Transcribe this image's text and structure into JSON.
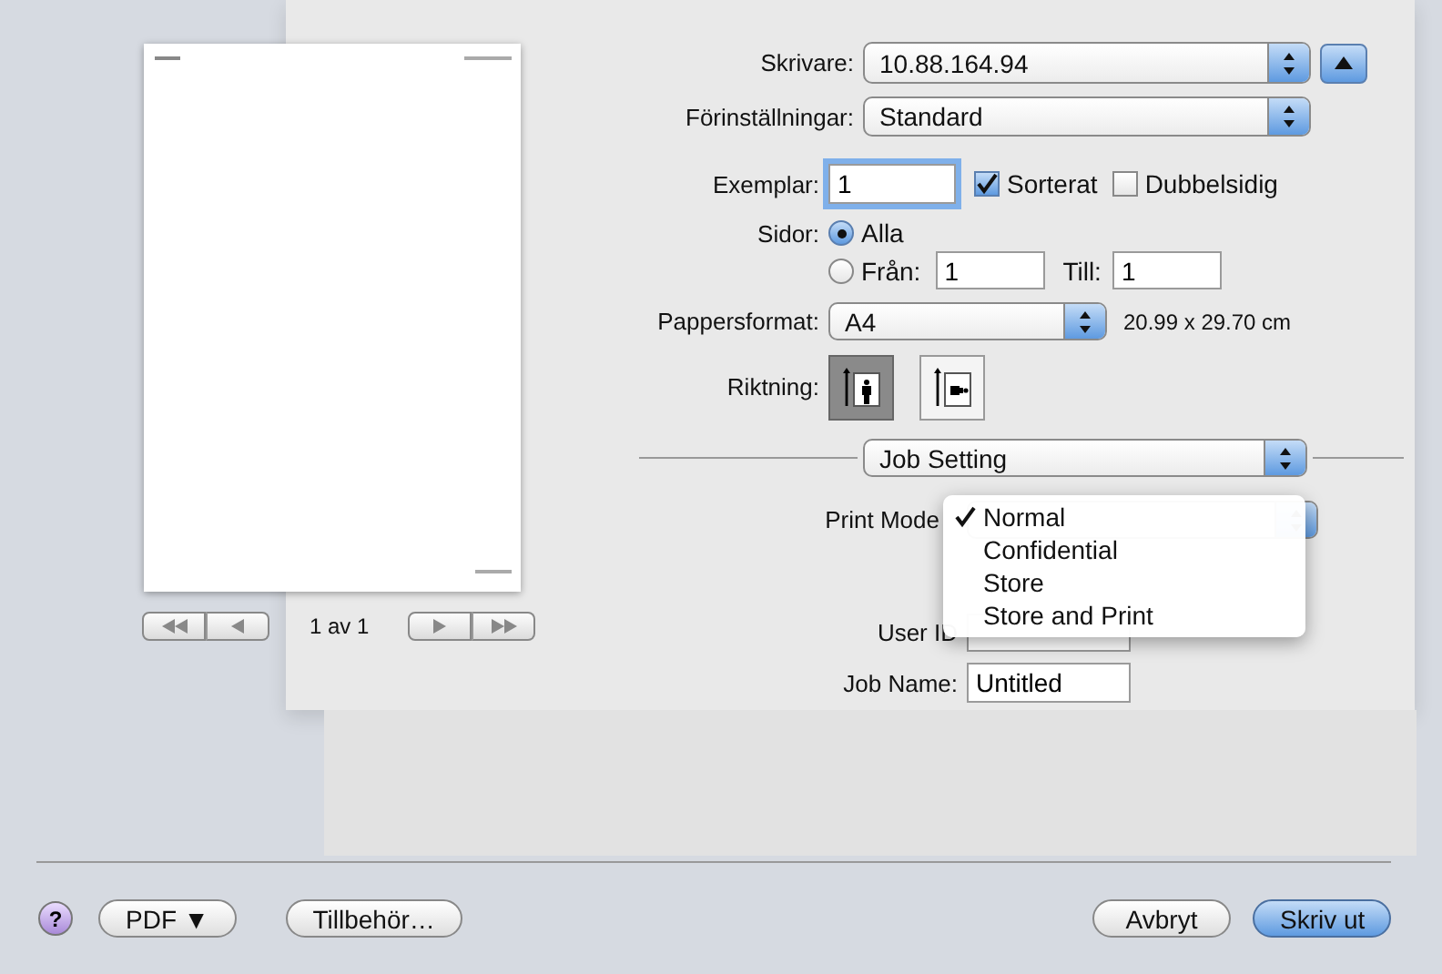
{
  "preview": {
    "page_label": "1 av 1"
  },
  "printer": {
    "label": "Skrivare:",
    "value": "10.88.164.94",
    "expanded": true
  },
  "presets": {
    "label": "Förinställningar:",
    "value": "Standard"
  },
  "copies": {
    "label": "Exemplar:",
    "value": "1",
    "collated": {
      "label": "Sorterat",
      "checked": true
    },
    "two_sided": {
      "label": "Dubbelsidig",
      "checked": false
    }
  },
  "pages": {
    "label": "Sidor:",
    "options": [
      {
        "label": "Alla",
        "selected": true
      },
      {
        "label": "Från:",
        "selected": false
      }
    ],
    "from": "1",
    "to_label": "Till:",
    "to": "1"
  },
  "paper_size": {
    "label": "Pappersformat:",
    "value": "A4",
    "dimensions": "20.99 x 29.70 cm"
  },
  "orientation": {
    "label": "Riktning:",
    "options": [
      {
        "kind": "portrait",
        "selected": true
      },
      {
        "kind": "landscape",
        "selected": false
      }
    ]
  },
  "section_popup": {
    "value": "Job Setting"
  },
  "print_mode": {
    "label": "Print Mode",
    "menu": [
      {
        "label": "Normal",
        "selected": true
      },
      {
        "label": "Confidential",
        "selected": false
      },
      {
        "label": "Store",
        "selected": false
      },
      {
        "label": "Store and Print",
        "selected": false
      }
    ]
  },
  "user_id": {
    "label": "User ID"
  },
  "job_name": {
    "label": "Job Name:",
    "value": "Untitled"
  },
  "buttons": {
    "help": "?",
    "pdf": "PDF ▼",
    "accessories": "Tillbehör…",
    "cancel": "Avbryt",
    "print": "Skriv ut"
  }
}
